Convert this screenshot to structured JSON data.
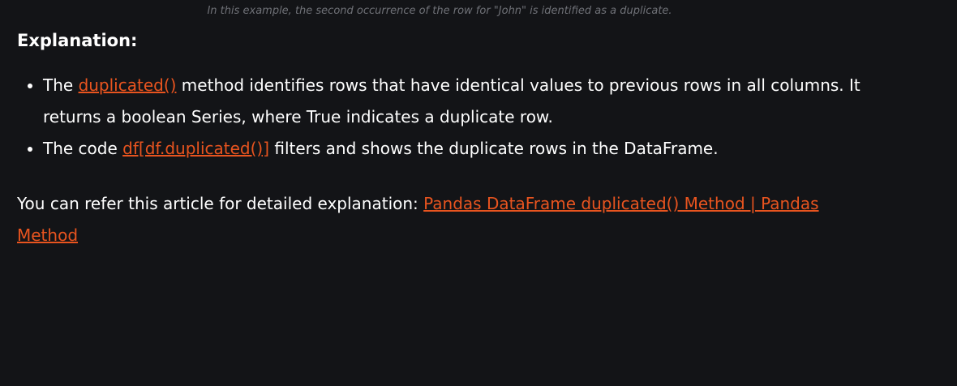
{
  "caption": "In this example, the second occurrence of the row for \"John\" is identified as a duplicate.",
  "heading": "Explanation:",
  "bullets": [
    {
      "pre": "The ",
      "link": "duplicated()",
      "post": " method identifies rows that have identical values to previous rows in all columns. It returns a boolean Series, where True indicates a duplicate row."
    },
    {
      "pre": "The code ",
      "link": "df[df.duplicated()]",
      "post": " filters and shows the duplicate rows in the DataFrame."
    }
  ],
  "refer": {
    "text": "You can refer this article for detailed explanation: ",
    "link": "Pandas DataFrame duplicated() Method | Pandas Method"
  },
  "colors": {
    "background": "#131417",
    "link": "#e8541f"
  }
}
